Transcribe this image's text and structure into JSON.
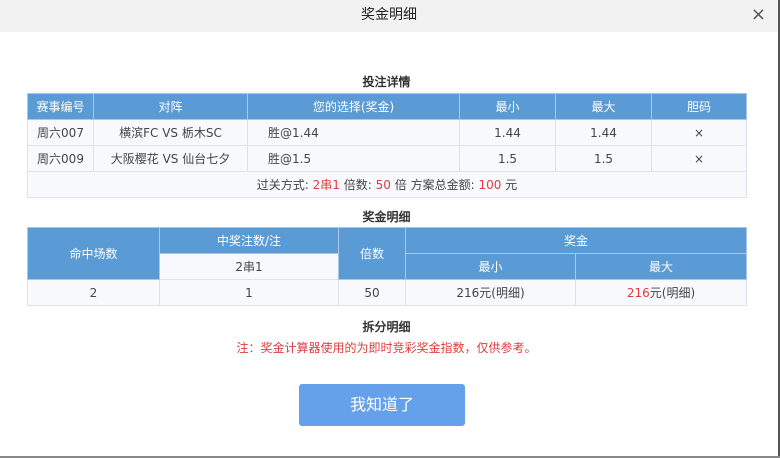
{
  "dialog": {
    "title": "奖金明细",
    "close_icon": "×"
  },
  "bet_details": {
    "title": "投注详情",
    "headers": [
      "赛事编号",
      "对阵",
      "您的选择(奖金)",
      "最小",
      "最大",
      "胆码"
    ],
    "rows": [
      [
        "周六007",
        "横滨FC VS 栃木SC",
        "胜@1.44",
        "1.44",
        "1.44",
        "×"
      ],
      [
        "周六009",
        "大阪樱花 VS 仙台七夕",
        "胜@1.5",
        "1.5",
        "1.5",
        "×"
      ]
    ],
    "summary": {
      "mode_label": "过关方式:",
      "mode": "2串1",
      "multiple_label": "倍数:",
      "multiple": "50",
      "multiple_unit": "倍",
      "total_label": "方案总金额:",
      "total": "100",
      "total_unit": "元"
    }
  },
  "prize_details": {
    "title": "奖金明细",
    "headers": {
      "hits": "命中场数",
      "winning_bets": "中奖注数/注",
      "pass_type": "2串1",
      "multiple": "倍数",
      "prize": "奖金",
      "min": "最小",
      "max": "最大"
    },
    "row": {
      "hits": "2",
      "winning_bets": "1",
      "multiple": "50",
      "min": "216元(明细)",
      "max_value": "216",
      "max_suffix": "元(明细)"
    }
  },
  "split_details": {
    "title": "拆分明细",
    "note": "注：奖金计算器使用的为即时竞彩奖金指数，仅供参考。"
  },
  "confirm_button": "我知道了"
}
